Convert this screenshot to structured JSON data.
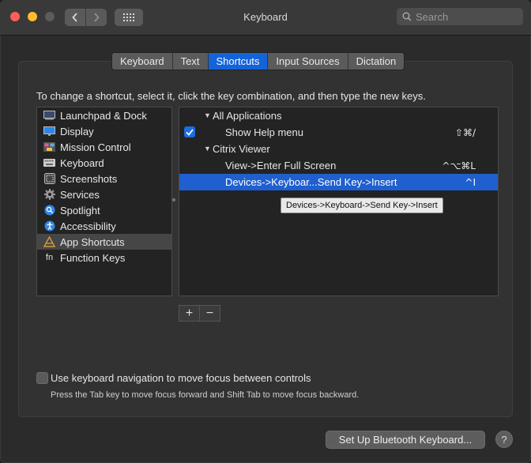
{
  "window": {
    "title": "Keyboard",
    "search_placeholder": "Search"
  },
  "tabs": [
    {
      "label": "Keyboard",
      "active": false
    },
    {
      "label": "Text",
      "active": false
    },
    {
      "label": "Shortcuts",
      "active": true
    },
    {
      "label": "Input Sources",
      "active": false
    },
    {
      "label": "Dictation",
      "active": false
    }
  ],
  "instructions": "To change a shortcut, select it, click the key combination, and then type the new keys.",
  "categories": [
    {
      "label": "Launchpad & Dock",
      "icon": "launchpad-icon"
    },
    {
      "label": "Display",
      "icon": "display-icon"
    },
    {
      "label": "Mission Control",
      "icon": "mission-control-icon"
    },
    {
      "label": "Keyboard",
      "icon": "keyboard-icon"
    },
    {
      "label": "Screenshots",
      "icon": "screenshots-icon"
    },
    {
      "label": "Services",
      "icon": "gear-icon"
    },
    {
      "label": "Spotlight",
      "icon": "spotlight-icon"
    },
    {
      "label": "Accessibility",
      "icon": "accessibility-icon"
    },
    {
      "label": "App Shortcuts",
      "icon": "app-shortcuts-icon",
      "selected": true
    },
    {
      "label": "Function Keys",
      "icon": "fn-icon",
      "icon_text": "fn"
    }
  ],
  "shortcuts": {
    "group1": {
      "label": "All Applications"
    },
    "item1": {
      "label": "Show Help menu",
      "keys": "⇧⌘/",
      "checked": true
    },
    "group2": {
      "label": "Citrix Viewer"
    },
    "item2": {
      "label": "View->Enter Full Screen",
      "keys": "^⌥⌘L"
    },
    "item3": {
      "label": "Devices->Keyboar...Send Key->Insert",
      "keys": "^I",
      "selected": true
    }
  },
  "tooltip": "Devices->Keyboard->Send Key->Insert",
  "buttons": {
    "add": "+",
    "remove": "−",
    "bluetooth": "Set Up Bluetooth Keyboard...",
    "help": "?"
  },
  "keyboard_nav": {
    "label": "Use keyboard navigation to move focus between controls",
    "note": "Press the Tab key to move focus forward and Shift Tab to move focus backward.",
    "checked": false
  },
  "colors": {
    "accent": "#1463d9",
    "selection": "#1f5fcf"
  }
}
